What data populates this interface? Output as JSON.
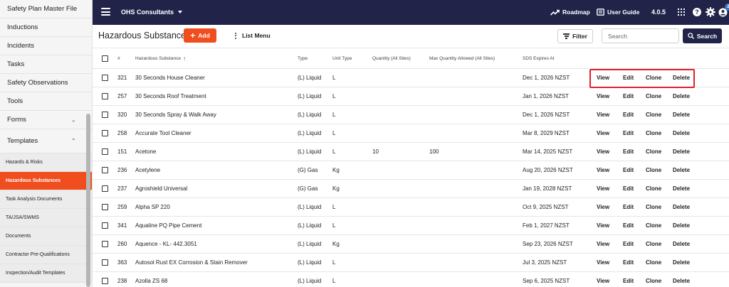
{
  "sidebar": {
    "items": [
      {
        "label": "Safety Plan Master File",
        "chevron": ""
      },
      {
        "label": "Inductions",
        "chevron": ""
      },
      {
        "label": "Incidents",
        "chevron": ""
      },
      {
        "label": "Tasks",
        "chevron": ""
      },
      {
        "label": "Safety Observations",
        "chevron": ""
      },
      {
        "label": "Tools",
        "chevron": ""
      },
      {
        "label": "Forms",
        "chevron": "⌄"
      },
      {
        "label": "Templates",
        "chevron": "⌃"
      }
    ],
    "sub_items": [
      {
        "label": "Hazards & Risks",
        "active": false
      },
      {
        "label": "Hazardous Substances",
        "active": true
      },
      {
        "label": "Task Analysis Documents",
        "active": false
      },
      {
        "label": "TA/JSA/SWMS",
        "active": false
      },
      {
        "label": "Documents",
        "active": false
      },
      {
        "label": "Contractor Pre-Qualifications",
        "active": false
      },
      {
        "label": "Inspection/Audit Templates",
        "active": false
      }
    ]
  },
  "topbar": {
    "org_name": "OHS Consultants",
    "roadmap_label": "Roadmap",
    "user_guide_label": "User Guide",
    "version": "4.0.5",
    "help_glyph": "?",
    "notification_count": "2",
    "background": "#212448"
  },
  "toolbar": {
    "title": "Hazardous Substances",
    "add_label": "Add",
    "list_menu_label": "List Menu",
    "filter_label": "Filter",
    "search_placeholder": "Search",
    "search_label": "Search",
    "accent": "#f04e1f"
  },
  "table": {
    "headers": {
      "num": "#",
      "substance": "Hazardous Substance",
      "sort_glyph": "↑",
      "type": "Type",
      "unit": "Unit Type",
      "qty": "Quantity (All Sites)",
      "maxqty": "Max Quantity Allowed (All Sites)",
      "sds": "SDS Expires At"
    },
    "actions": {
      "view": "View",
      "edit": "Edit",
      "clone": "Clone",
      "delete": "Delete"
    },
    "rows": [
      {
        "num": "321",
        "name": "30 Seconds House Cleaner",
        "type": "(L) Liquid",
        "unit": "L",
        "qty": "",
        "maxqty": "",
        "sds": "Dec 1, 2026 NZST"
      },
      {
        "num": "257",
        "name": "30 Seconds Roof Treatment",
        "type": "(L) Liquid",
        "unit": "L",
        "qty": "",
        "maxqty": "",
        "sds": "Jan 1, 2026 NZST"
      },
      {
        "num": "320",
        "name": "30 Seconds Spray & Walk Away",
        "type": "(L) Liquid",
        "unit": "L",
        "qty": "",
        "maxqty": "",
        "sds": "Dec 1, 2026 NZST"
      },
      {
        "num": "258",
        "name": "Accurate Tool Cleaner",
        "type": "(L) Liquid",
        "unit": "L",
        "qty": "",
        "maxqty": "",
        "sds": "Mar 8, 2029 NZST"
      },
      {
        "num": "151",
        "name": "Acetone",
        "type": "(L) Liquid",
        "unit": "L",
        "qty": "10",
        "maxqty": "100",
        "sds": "Mar 14, 2025 NZST"
      },
      {
        "num": "236",
        "name": "Acetylene",
        "type": "(G) Gas",
        "unit": "Kg",
        "qty": "",
        "maxqty": "",
        "sds": "Aug 20, 2026 NZST"
      },
      {
        "num": "237",
        "name": "Agroshield Universal",
        "type": "(G) Gas",
        "unit": "Kg",
        "qty": "",
        "maxqty": "",
        "sds": "Jan 19, 2028 NZST"
      },
      {
        "num": "259",
        "name": "Alpha SP 220",
        "type": "(L) Liquid",
        "unit": "L",
        "qty": "",
        "maxqty": "",
        "sds": "Oct 9, 2025 NZST"
      },
      {
        "num": "341",
        "name": "Aqualine PQ Pipe Cement",
        "type": "(L) Liquid",
        "unit": "L",
        "qty": "",
        "maxqty": "",
        "sds": "Feb 1, 2027 NZST"
      },
      {
        "num": "260",
        "name": "Aquence - KL- 442.3051",
        "type": "(L) Liquid",
        "unit": "Kg",
        "qty": "",
        "maxqty": "",
        "sds": "Sep 23, 2026 NZST"
      },
      {
        "num": "363",
        "name": "Autosol Rust EX Corrosion & Stain Remover",
        "type": "(L) Liquid",
        "unit": "L",
        "qty": "",
        "maxqty": "",
        "sds": "Jul 3, 2025 NZST"
      },
      {
        "num": "238",
        "name": "Azolla ZS 68",
        "type": "(L) Liquid",
        "unit": "L",
        "qty": "",
        "maxqty": "",
        "sds": "Sep 6, 2025 NZST"
      }
    ],
    "highlight_color": "#e0202a"
  }
}
